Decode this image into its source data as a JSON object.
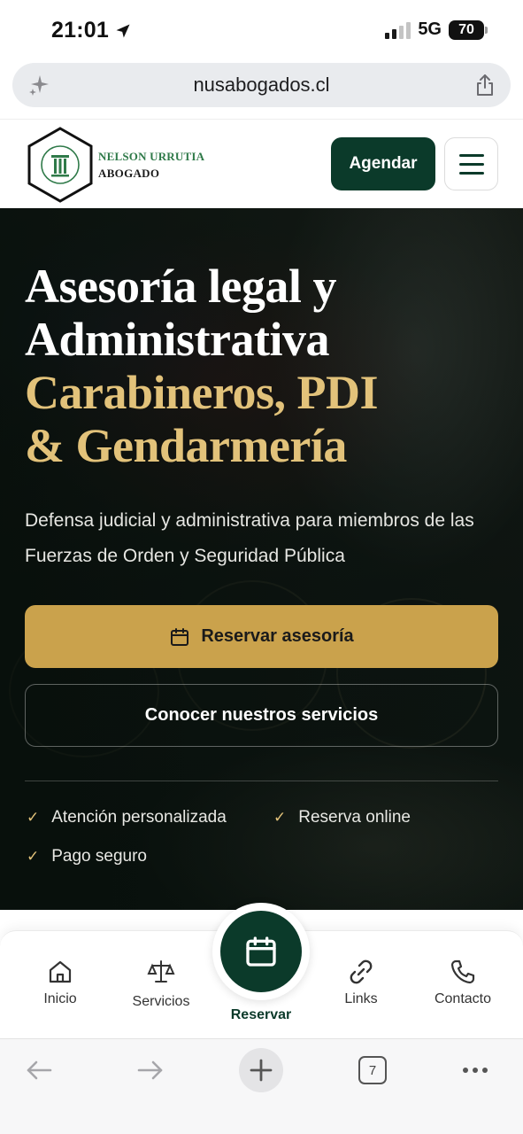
{
  "status_bar": {
    "time": "21:01",
    "network": "5G",
    "battery": "70"
  },
  "browser": {
    "url": "nusabogados.cl",
    "tabs_count": "7"
  },
  "header": {
    "brand_name": "NELSON URRUTIA",
    "brand_subtitle": "ABOGADO",
    "cta_label": "Agendar",
    "menu_icon": "hamburger-icon"
  },
  "hero": {
    "title_line1": "Asesoría legal y",
    "title_line2": "Administrativa",
    "title_line3": "Carabineros, PDI",
    "title_line4": "& Gendarmería",
    "description": "Defensa judicial y administrativa para miembros de las Fuerzas de Orden y Seguridad Pública",
    "primary_button": "Reservar asesoría",
    "secondary_button": "Conocer nuestros servicios",
    "features": [
      "Atención personalizada",
      "Reserva online",
      "Pago seguro"
    ]
  },
  "tabbar": {
    "items": [
      {
        "label": "Inicio",
        "icon": "home-icon"
      },
      {
        "label": "Servicios",
        "icon": "scales-icon"
      },
      {
        "label": "Reservar",
        "icon": "calendar-icon"
      },
      {
        "label": "Links",
        "icon": "link-icon"
      },
      {
        "label": "Contacto",
        "icon": "phone-icon"
      }
    ]
  },
  "colors": {
    "brand_green": "#0b3a2a",
    "gold": "#caa24c",
    "gold_text": "#e2c27a"
  }
}
